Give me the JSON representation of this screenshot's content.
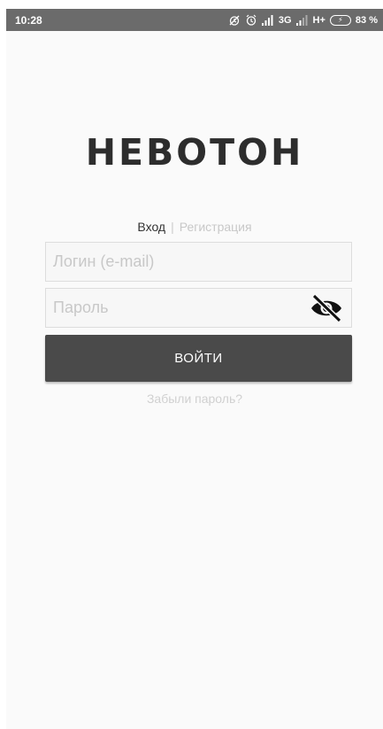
{
  "status_bar": {
    "time": "10:28",
    "network_3g": "3G",
    "network_hplus": "H+",
    "battery": "83 %",
    "icons": [
      "alarm-off-icon",
      "alarm-icon",
      "signal-icon",
      "signal-icon",
      "battery-charging-icon"
    ]
  },
  "logo": {
    "text": "НЕВОТОН"
  },
  "tabs": {
    "login": "Вход",
    "separator": "|",
    "register": "Регистрация"
  },
  "form": {
    "login_placeholder": "Логин (e-mail)",
    "login_value": "",
    "password_placeholder": "Пароль",
    "password_value": "",
    "password_toggle_icon": "eye-off-icon",
    "submit_label": "ВОЙТИ",
    "forgot_label": "Забыли пароль?"
  },
  "colors": {
    "background": "#fafafa",
    "status_bar": "#6b6b6b",
    "button": "#4a4a4a",
    "logo": "#2d2d2d",
    "muted_text": "#c8c8c8"
  }
}
